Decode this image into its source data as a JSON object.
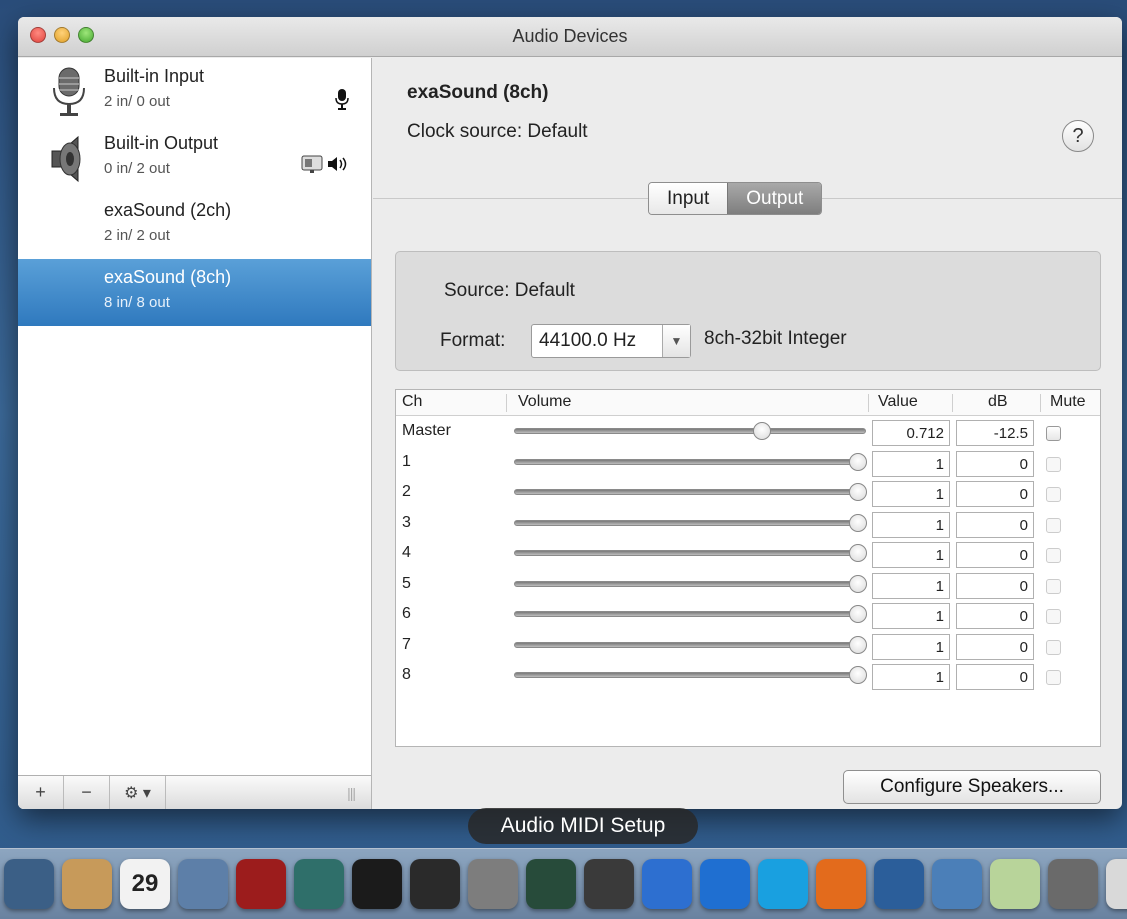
{
  "window": {
    "title": "Audio Devices"
  },
  "sidebar": {
    "devices": [
      {
        "name": "Built-in Input",
        "io": "2 in/ 0 out"
      },
      {
        "name": "Built-in Output",
        "io": "0 in/ 2 out"
      },
      {
        "name": "exaSound (2ch)",
        "io": "2 in/ 2 out"
      },
      {
        "name": "exaSound (8ch)",
        "io": "8 in/ 8 out"
      }
    ],
    "toolbar": {
      "plus": "+",
      "minus": "−",
      "gear": "⚙ ▾",
      "grip": "|||"
    }
  },
  "main": {
    "device_title": "exaSound (8ch)",
    "clock_source": "Clock source:  Default",
    "help": "?",
    "tabs": {
      "input": "Input",
      "output": "Output"
    },
    "source": "Source:  Default",
    "format_label": "Format:",
    "format_value": "44100.0 Hz",
    "format_bits": "8ch-32bit Integer",
    "table": {
      "headers": {
        "ch": "Ch",
        "volume": "Volume",
        "value": "Value",
        "db": "dB",
        "mute": "Mute"
      },
      "rows": [
        {
          "ch": "Master",
          "volume": 0.712,
          "value": "0.712",
          "db": "-12.5"
        },
        {
          "ch": "1",
          "volume": 1,
          "value": "1",
          "db": "0"
        },
        {
          "ch": "2",
          "volume": 1,
          "value": "1",
          "db": "0"
        },
        {
          "ch": "3",
          "volume": 1,
          "value": "1",
          "db": "0"
        },
        {
          "ch": "4",
          "volume": 1,
          "value": "1",
          "db": "0"
        },
        {
          "ch": "5",
          "volume": 1,
          "value": "1",
          "db": "0"
        },
        {
          "ch": "6",
          "volume": 1,
          "value": "1",
          "db": "0"
        },
        {
          "ch": "7",
          "volume": 1,
          "value": "1",
          "db": "0"
        },
        {
          "ch": "8",
          "volume": 1,
          "value": "1",
          "db": "0"
        }
      ]
    },
    "configure_button": "Configure Speakers..."
  },
  "dock": {
    "tooltip": "Audio MIDI Setup",
    "calendar_day": "29",
    "apps": [
      {
        "name": "facetime-icon",
        "color": "#3b5f86"
      },
      {
        "name": "contacts-icon",
        "color": "#c79a5a"
      },
      {
        "name": "calendar-icon",
        "color": "#f2f2f2"
      },
      {
        "name": "preview-icon",
        "color": "#5d7fa8"
      },
      {
        "name": "photo-booth-icon",
        "color": "#9c1c1c"
      },
      {
        "name": "time-machine-icon",
        "color": "#2f6f6a"
      },
      {
        "name": "terminal-icon",
        "color": "#1b1b1b"
      },
      {
        "name": "console-icon",
        "color": "#2a2a2a"
      },
      {
        "name": "system-preferences-icon",
        "color": "#7d7d7d"
      },
      {
        "name": "activity-monitor-icon",
        "color": "#274b3a"
      },
      {
        "name": "audio-midi-setup-icon",
        "color": "#3a3a3a"
      },
      {
        "name": "itunes-icon",
        "color": "#2d6fd0"
      },
      {
        "name": "teamviewer-icon",
        "color": "#1f6fd1"
      },
      {
        "name": "skype-icon",
        "color": "#19a0e0"
      },
      {
        "name": "firefox-icon",
        "color": "#e36b1c"
      },
      {
        "name": "xcode-icon",
        "color": "#2b5e9a"
      },
      {
        "name": "instruments-icon",
        "color": "#4b7fb8"
      },
      {
        "name": "sound-utility-icon",
        "color": "#b8d49a"
      },
      {
        "name": "script-editor-icon",
        "color": "#6a6a6a"
      },
      {
        "name": "textedit-icon",
        "color": "#d9d9d9"
      }
    ]
  }
}
